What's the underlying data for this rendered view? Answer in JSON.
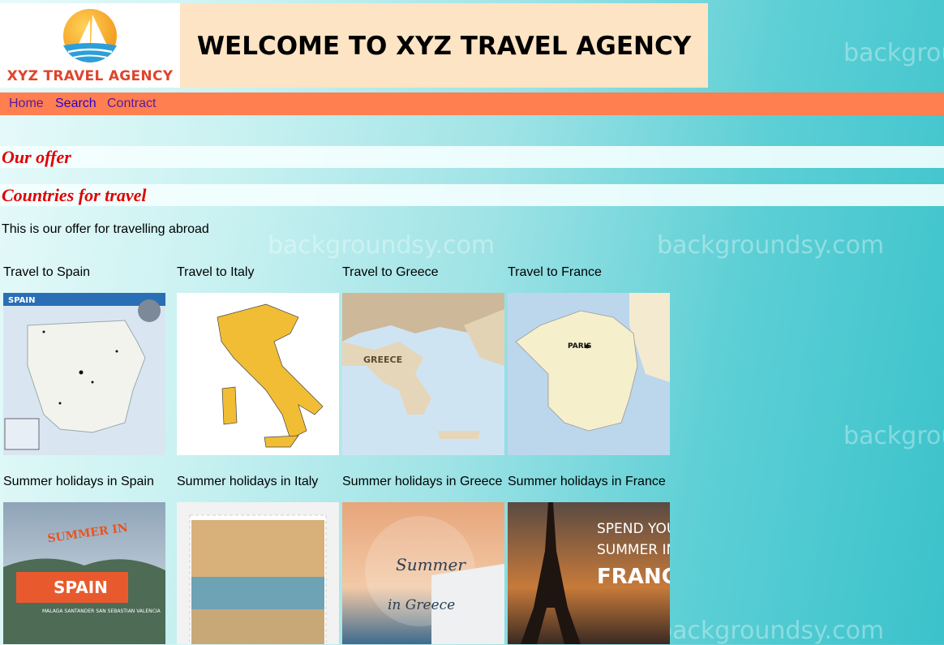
{
  "header": {
    "logo_text": "XYZ TRAVEL AGENCY",
    "welcome": "WELCOME TO XYZ TRAVEL AGENCY"
  },
  "nav": [
    {
      "label": "Home"
    },
    {
      "label": "Search"
    },
    {
      "label": "Contract"
    }
  ],
  "sections": {
    "offer_heading": "Our offer",
    "countries_heading": "Countries for travel",
    "intro": "This is our offer for travelling abroad"
  },
  "travel": [
    {
      "caption": "Travel to Spain",
      "map_title": "SPAIN"
    },
    {
      "caption": "Travel to Italy"
    },
    {
      "caption": "Travel to Greece",
      "map_title": "GREECE"
    },
    {
      "caption": "Travel to France",
      "map_title": "PARIS"
    }
  ],
  "holidays": [
    {
      "caption": "Summer holidays in Spain",
      "poster_top": "SUMMER IN",
      "poster_main": "SPAIN",
      "poster_sub": "MALAGA  SANTANDER  SAN SEBASTIAN  VALENCIA"
    },
    {
      "caption": "Summer holidays in Italy"
    },
    {
      "caption": "Summer holidays in Greece",
      "poster_top": "Summer",
      "poster_main": "in Greece"
    },
    {
      "caption": "Summer holidays in France",
      "poster_top": "SPEND YOUR",
      "poster_mid": "SUMMER IN",
      "poster_main": "FRANCE"
    }
  ],
  "watermark": "backgroundsy.com",
  "colors": {
    "nav_bg": "#ff7f50",
    "heading": "#e00000",
    "header_bg": "#fde4c4"
  }
}
